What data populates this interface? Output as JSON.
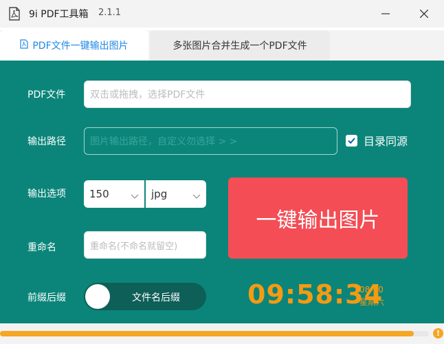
{
  "app": {
    "title": "9i PDF工具箱",
    "version": "2.1.1"
  },
  "window": {
    "minimize_icon": "minimize-icon",
    "close_icon": "close-icon"
  },
  "tabs": [
    {
      "label": "PDF文件一键输出图片",
      "icon": "pdf-file-icon",
      "active": true
    },
    {
      "label": "多张图片合并生成一个PDF文件",
      "active": false
    }
  ],
  "form": {
    "pdf_file": {
      "label": "PDF文件",
      "placeholder": "双击或拖拽，选择PDF文件"
    },
    "output_path": {
      "label": "输出路径",
      "placeholder": "图片输出路径，自定义勿选择 > >",
      "same_dir_checkbox": {
        "label": "目录同源",
        "checked": true
      }
    },
    "output_options": {
      "label": "输出选项",
      "dpi": "150",
      "format": "jpg"
    },
    "rename": {
      "label": "重命名",
      "placeholder": "重命名(不命名就留空)"
    },
    "prefix_suffix": {
      "label": "前缀后缀",
      "toggle_text": "文件名后缀"
    },
    "export_button": "一键输出图片"
  },
  "clock": {
    "time": "09:58:34",
    "date": "08-30",
    "weekday": "星期六"
  },
  "progress": {
    "fraction": 0.965
  },
  "colors": {
    "panel": "#0b857a",
    "accent_blue": "#1e88e5",
    "export_button": "#f44d55",
    "clock": "#f49a13",
    "progress": "#f5a623"
  }
}
